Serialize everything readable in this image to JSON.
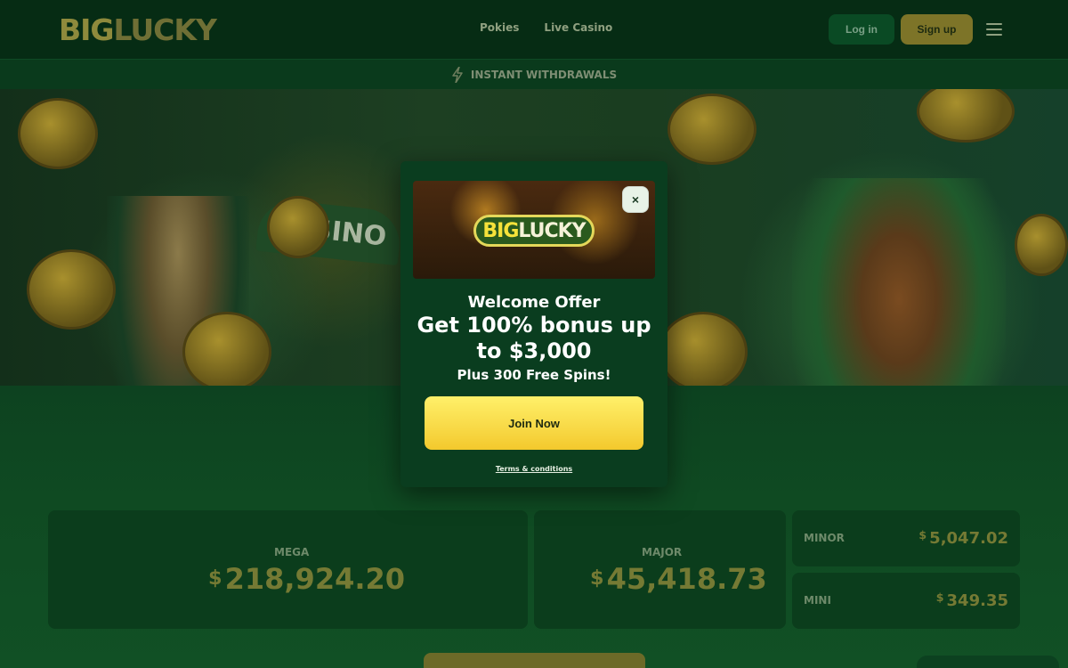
{
  "header": {
    "logo_big": "BIG",
    "logo_lucky": "LUCKY",
    "nav": [
      "Pokies",
      "Live Casino"
    ],
    "login_label": "Log in",
    "signup_label": "Sign up"
  },
  "promo_strip": {
    "text": "INSTANT WITHDRAWALS",
    "icon": "lightning-bolt-icon"
  },
  "hero": {
    "sign_text": "CASINO"
  },
  "jackpots": {
    "currency": "$",
    "mega": {
      "label": "MEGA",
      "value": "218,924.20"
    },
    "major": {
      "label": "MAJOR",
      "value": "45,418.73"
    },
    "minor": {
      "label": "MINOR",
      "value": "5,047.02"
    },
    "mini": {
      "label": "MINI",
      "value": "349.35"
    }
  },
  "modal": {
    "logo_big": "BIG",
    "logo_lucky": "LUCKY",
    "close_symbol": "×",
    "title": "Welcome Offer",
    "headline_line1": "Get 100% bonus up",
    "headline_line2": "to $3,000",
    "subline": "Plus 300 Free Spins!",
    "cta_label": "Join Now",
    "terms_label": "Terms & conditions"
  },
  "colors": {
    "accent_yellow": "#f3c92d",
    "brand_green": "#0a3d1f",
    "header_bg": "#062c14"
  }
}
